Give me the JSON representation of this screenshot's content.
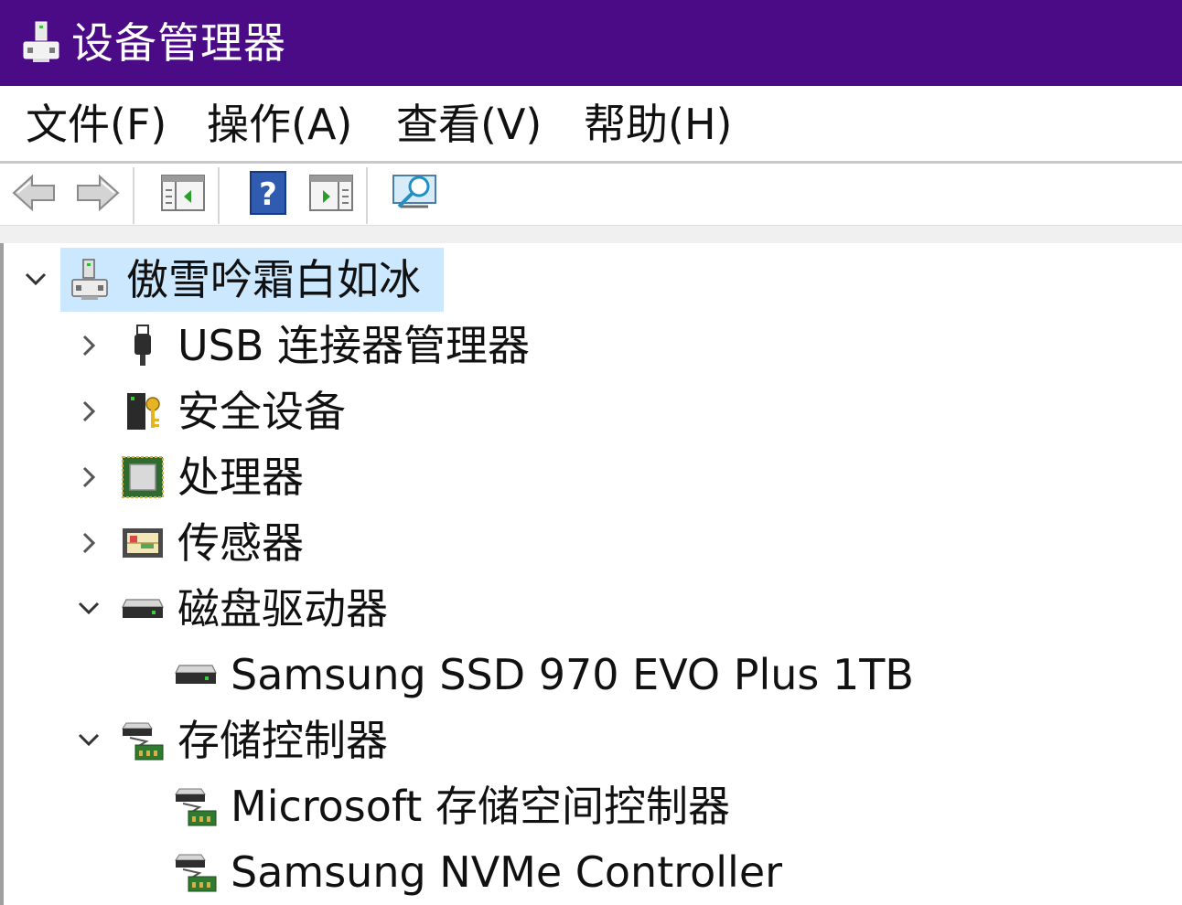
{
  "window": {
    "title": "设备管理器",
    "accent_color": "#4b0a86",
    "icon": "computer-icon"
  },
  "menu": [
    {
      "label": "文件(F)"
    },
    {
      "label": "操作(A)"
    },
    {
      "label": "查看(V)"
    },
    {
      "label": "帮助(H)"
    }
  ],
  "toolbar": {
    "buttons": [
      {
        "icon": "back-arrow-icon"
      },
      {
        "icon": "forward-arrow-icon"
      },
      {
        "icon": "properties-pane-icon"
      },
      {
        "icon": "help-icon"
      },
      {
        "icon": "update-driver-icon"
      },
      {
        "icon": "scan-hardware-icon"
      }
    ]
  },
  "tree": {
    "root": {
      "label": "傲雪吟霜白如冰",
      "icon": "computer-icon",
      "expanded": true,
      "selected": true
    },
    "nodes": [
      {
        "label": "USB 连接器管理器",
        "icon": "usb-connector-icon",
        "expanded": false
      },
      {
        "label": "安全设备",
        "icon": "security-device-icon",
        "expanded": false
      },
      {
        "label": "处理器",
        "icon": "processor-icon",
        "expanded": false
      },
      {
        "label": "传感器",
        "icon": "sensor-icon",
        "expanded": false
      },
      {
        "label": "磁盘驱动器",
        "icon": "disk-drive-icon",
        "expanded": true,
        "children": [
          {
            "label": "Samsung SSD 970 EVO Plus 1TB",
            "icon": "disk-drive-icon"
          }
        ]
      },
      {
        "label": "存储控制器",
        "icon": "storage-controller-icon",
        "expanded": true,
        "children": [
          {
            "label": "Microsoft 存储空间控制器",
            "icon": "storage-controller-icon"
          },
          {
            "label": "Samsung NVMe Controller",
            "icon": "storage-controller-icon"
          }
        ]
      }
    ]
  }
}
